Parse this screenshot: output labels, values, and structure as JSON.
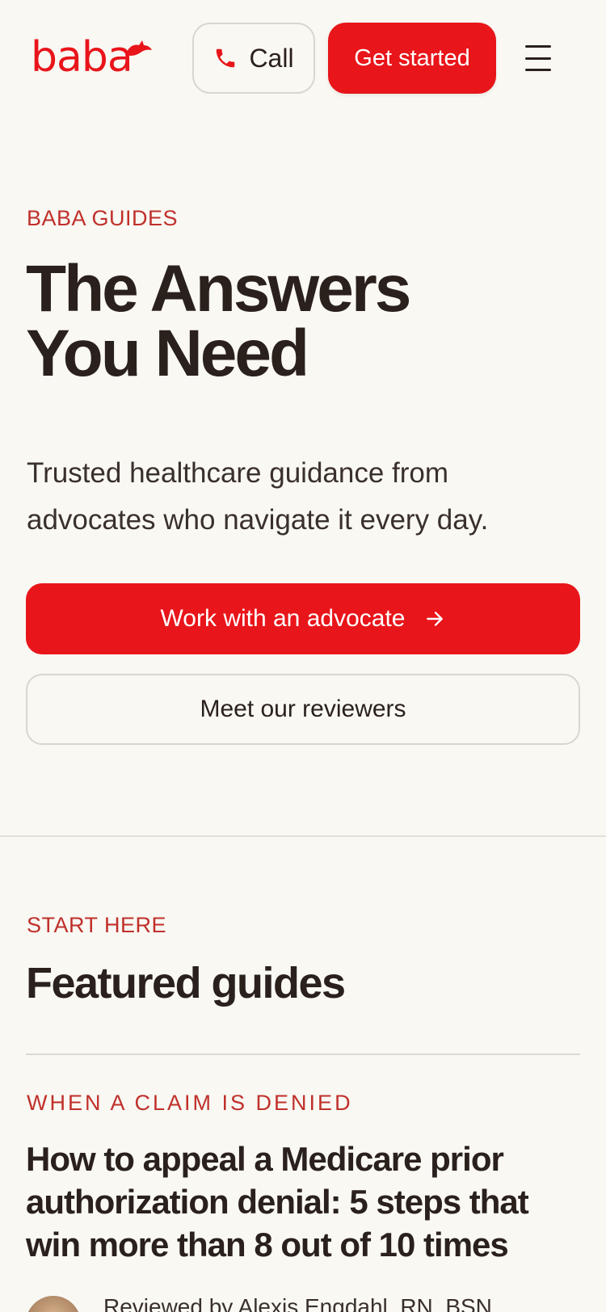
{
  "header": {
    "logo_text": "baba",
    "call_label": "Call",
    "get_started_label": "Get started"
  },
  "hero": {
    "eyebrow": "BABA GUIDES",
    "title_line1": "The Answers",
    "title_line2": "You Need",
    "subtitle": "Trusted healthcare guidance from advocates who navigate it every day.",
    "primary_cta": "Work with an advocate",
    "secondary_cta": "Meet our reviewers"
  },
  "featured": {
    "eyebrow": "START HERE",
    "title": "Featured guides",
    "guides": [
      {
        "category": "WHEN A CLAIM IS DENIED",
        "title": "How to appeal a Medicare prior authorization denial: 5 steps that win more than 8 out of 10 times",
        "reviewer": "Reviewed by Alexis Engdahl, RN, BSN"
      }
    ]
  },
  "colors": {
    "brand_red": "#E8151A",
    "eyebrow_red": "#C0302B",
    "background": "#F9F8F3",
    "text": "#2A201C"
  },
  "icons": {
    "phone": "phone-icon",
    "arrow": "arrow-right-icon",
    "menu": "hamburger-menu-icon",
    "logo_bird": "bird-icon"
  }
}
